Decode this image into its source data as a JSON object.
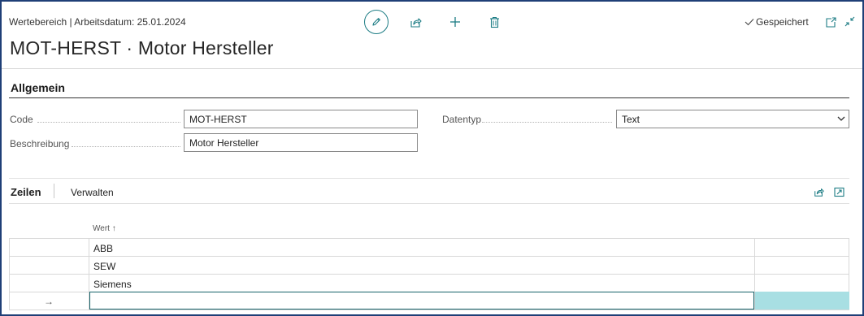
{
  "header": {
    "breadcrumb": "Wertebereich | Arbeitsdatum: 25.01.2024",
    "title": "MOT-HERST · Motor Hersteller",
    "saved_label": "Gespeichert"
  },
  "toolbar": {
    "icons": [
      "edit-icon",
      "share-icon",
      "plus-icon",
      "delete-icon"
    ]
  },
  "section": {
    "title": "Allgemein",
    "fields": {
      "code_label": "Code",
      "code_value": "MOT-HERST",
      "description_label": "Beschreibung",
      "description_value": "Motor Hersteller",
      "datatype_label": "Datentyp",
      "datatype_value": "Text"
    }
  },
  "lines": {
    "tab_active": "Zeilen",
    "tab_manage": "Verwalten",
    "column_header": "Wert ↑",
    "rows": [
      "ABB",
      "SEW",
      "Siemens"
    ],
    "new_row_marker": "→"
  },
  "colors": {
    "accent": "#1c7c84",
    "frame": "#1f3f77",
    "selection": "#a8dfe3"
  }
}
